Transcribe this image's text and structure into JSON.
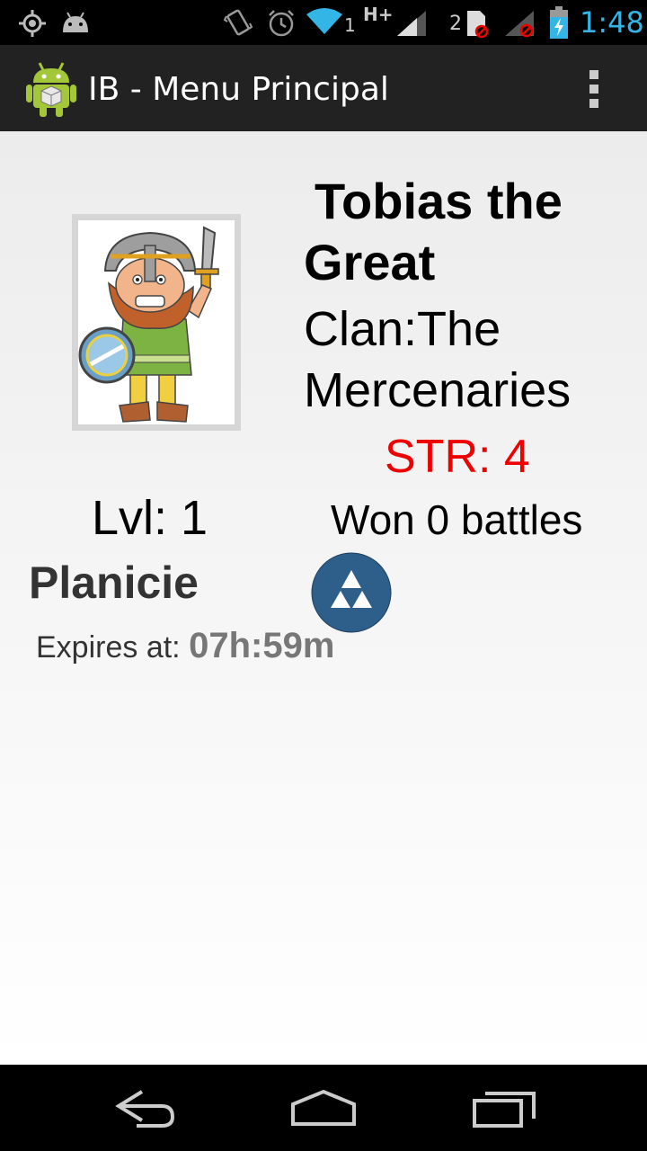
{
  "status_bar": {
    "time": "1:48",
    "network_badge": "H+",
    "sim1": "1",
    "sim2": "2",
    "icons": [
      "gps-icon",
      "android-debug-icon",
      "vibrate-icon",
      "alarm-icon",
      "wifi-icon",
      "signal-icon",
      "sim-icon",
      "signal-off-icon",
      "battery-charging-icon"
    ]
  },
  "action_bar": {
    "title": "IB - Menu Principal",
    "icon": "android-app-icon",
    "overflow_icon": "overflow-menu-icon"
  },
  "player": {
    "name": "Tobias the Great",
    "clan": "Clan:The Mercenaries",
    "str": "STR: 4",
    "level": "Lvl: 1",
    "battles": "Won 0 battles",
    "avatar": "viking-warrior-avatar"
  },
  "location": {
    "terrain": "Planicie",
    "terrain_icon": "mountain-icon",
    "expires_label": "Expires at: ",
    "expires_value": "07h:59m"
  },
  "colors": {
    "str": "#ee0000",
    "terrain_icon_bg": "#2e5f8a",
    "action_bar": "#222222"
  },
  "nav_bar": {
    "icons": [
      "back-icon",
      "home-icon",
      "recent-apps-icon"
    ]
  }
}
